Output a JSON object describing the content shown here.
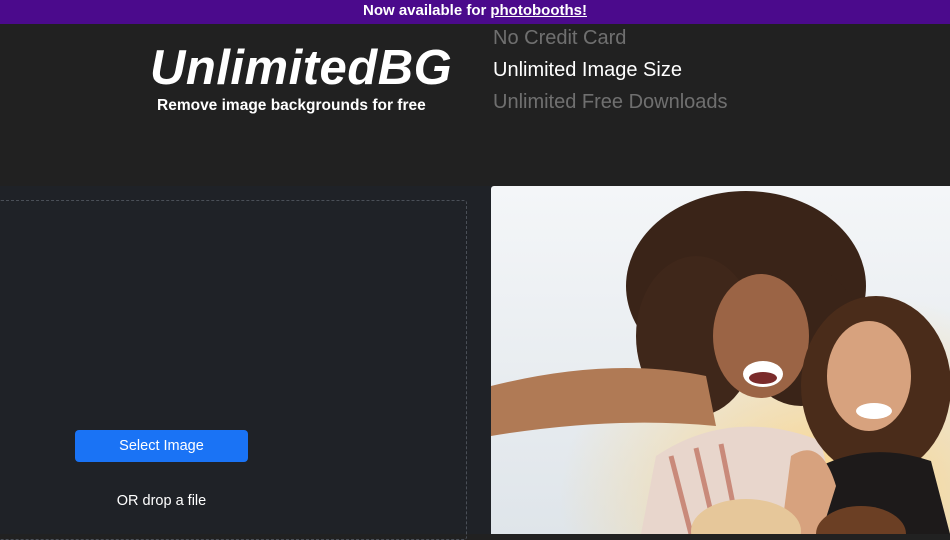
{
  "banner": {
    "text": "Now available for",
    "link": "photobooths!"
  },
  "header": {
    "logo": "UnlimitedBG",
    "tagline": "Remove image backgrounds for free",
    "features": [
      "No Credit Card",
      "Unlimited Image Size",
      "Unlimited Free Downloads"
    ]
  },
  "upload": {
    "select_label": "Select Image",
    "drop_label": "OR drop a file"
  },
  "colors": {
    "banner_bg": "#4b0a8c",
    "page_bg": "#212121",
    "main_bg": "#1f2227",
    "button_bg": "#1a73f5"
  },
  "sample": {
    "icon": "sample-photo-image"
  }
}
